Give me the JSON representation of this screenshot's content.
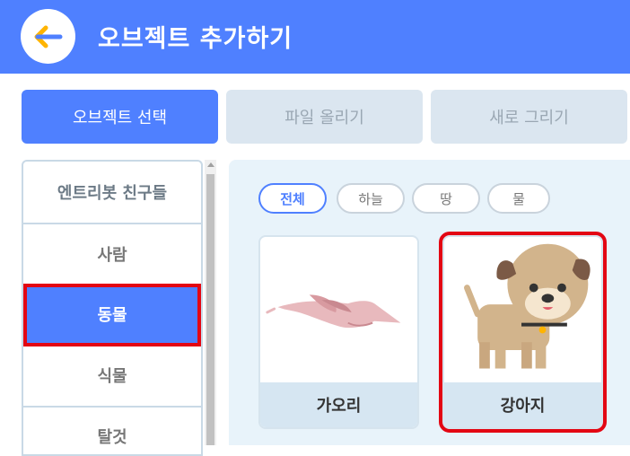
{
  "header": {
    "title": "오브젝트 추가하기",
    "back_icon": "back-arrow-icon"
  },
  "tabs": [
    {
      "label": "오브젝트 선택",
      "active": true
    },
    {
      "label": "파일 올리기",
      "active": false
    },
    {
      "label": "새로 그리기",
      "active": false
    }
  ],
  "sidebar": {
    "items": [
      {
        "label": "엔트리봇 친구들"
      },
      {
        "label": "사람"
      },
      {
        "label": "동물",
        "active": true
      },
      {
        "label": "식물"
      },
      {
        "label": "탈것"
      }
    ]
  },
  "filters": [
    {
      "label": "전체",
      "active": true
    },
    {
      "label": "하늘"
    },
    {
      "label": "땅"
    },
    {
      "label": "물"
    }
  ],
  "cards": [
    {
      "label": "가오리",
      "image": "stingray"
    },
    {
      "label": "강아지",
      "image": "puppy",
      "selected": true
    }
  ],
  "colors": {
    "brand": "#4f80ff",
    "accent_arrow": "#ffb400",
    "highlight": "#e30613"
  }
}
